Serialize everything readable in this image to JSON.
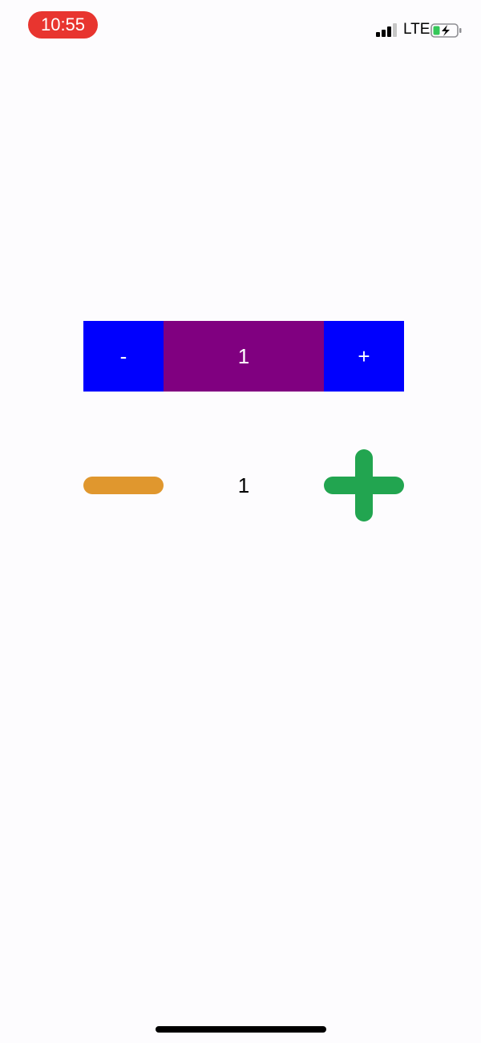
{
  "status_bar": {
    "time": "10:55",
    "network": "LTE",
    "icons": [
      "signal-bars-icon",
      "battery-charging-icon"
    ],
    "time_pill_color": "#e8352f",
    "battery_fill_color": "#35c759"
  },
  "stepper_colored": {
    "decrement_label": "-",
    "value": "1",
    "increment_label": "+",
    "button_color": "#0000fe",
    "value_bg_color": "#800080"
  },
  "stepper_icons": {
    "decrement_icon": "minus-icon",
    "value": "1",
    "increment_icon": "plus-icon",
    "minus_color": "#e0972e",
    "plus_color": "#22a550"
  }
}
